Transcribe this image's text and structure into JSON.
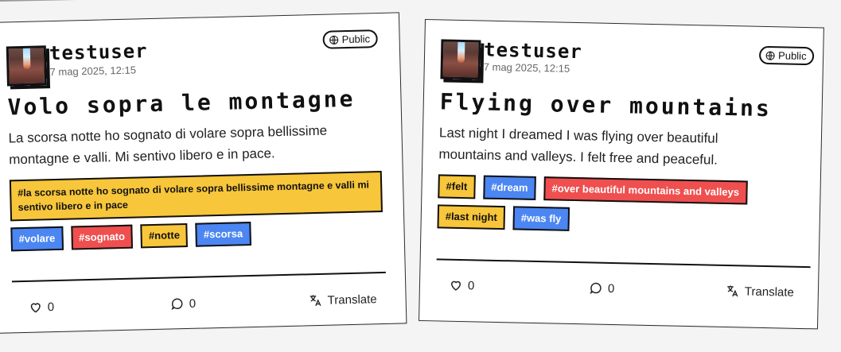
{
  "cards": [
    {
      "username": "testuser",
      "date": "7 mag 2025, 12:15",
      "visibility": "Public",
      "title": "Volo sopra le montagne",
      "body": "La scorsa notte ho sognato di volare sopra bellissime montagne e valli. Mi sentivo libero e in pace.",
      "tags": [
        {
          "label": "#la scorsa notte ho sognato di volare sopra bellissime montagne e valli mi sentivo libero e in pace",
          "color": "yellow"
        },
        {
          "label": "#volare",
          "color": "blue"
        },
        {
          "label": "#sognato",
          "color": "red"
        },
        {
          "label": "#notte",
          "color": "yellow"
        },
        {
          "label": "#scorsa",
          "color": "blue"
        }
      ],
      "likes": "0",
      "comments": "0",
      "translate_label": "Translate"
    },
    {
      "username": "testuser",
      "date": "7 mag 2025, 12:15",
      "visibility": "Public",
      "title": "Flying over mountains",
      "body": "Last night I dreamed I was flying over beautiful mountains and valleys. I felt free and peaceful.",
      "tags": [
        {
          "label": "#felt",
          "color": "yellow"
        },
        {
          "label": "#dream",
          "color": "blue"
        },
        {
          "label": "#over beautiful mountains and valleys",
          "color": "red"
        },
        {
          "label": "#last night",
          "color": "yellow"
        },
        {
          "label": "#was fly",
          "color": "blue"
        }
      ],
      "likes": "0",
      "comments": "0",
      "translate_label": "Translate"
    }
  ],
  "colors": {
    "yellow": "#f8c63a",
    "blue": "#4b86f2",
    "red": "#ef4f4f",
    "ink": "#111111"
  },
  "icons": [
    "globe-icon",
    "heart-icon",
    "comment-icon",
    "translate-icon"
  ]
}
